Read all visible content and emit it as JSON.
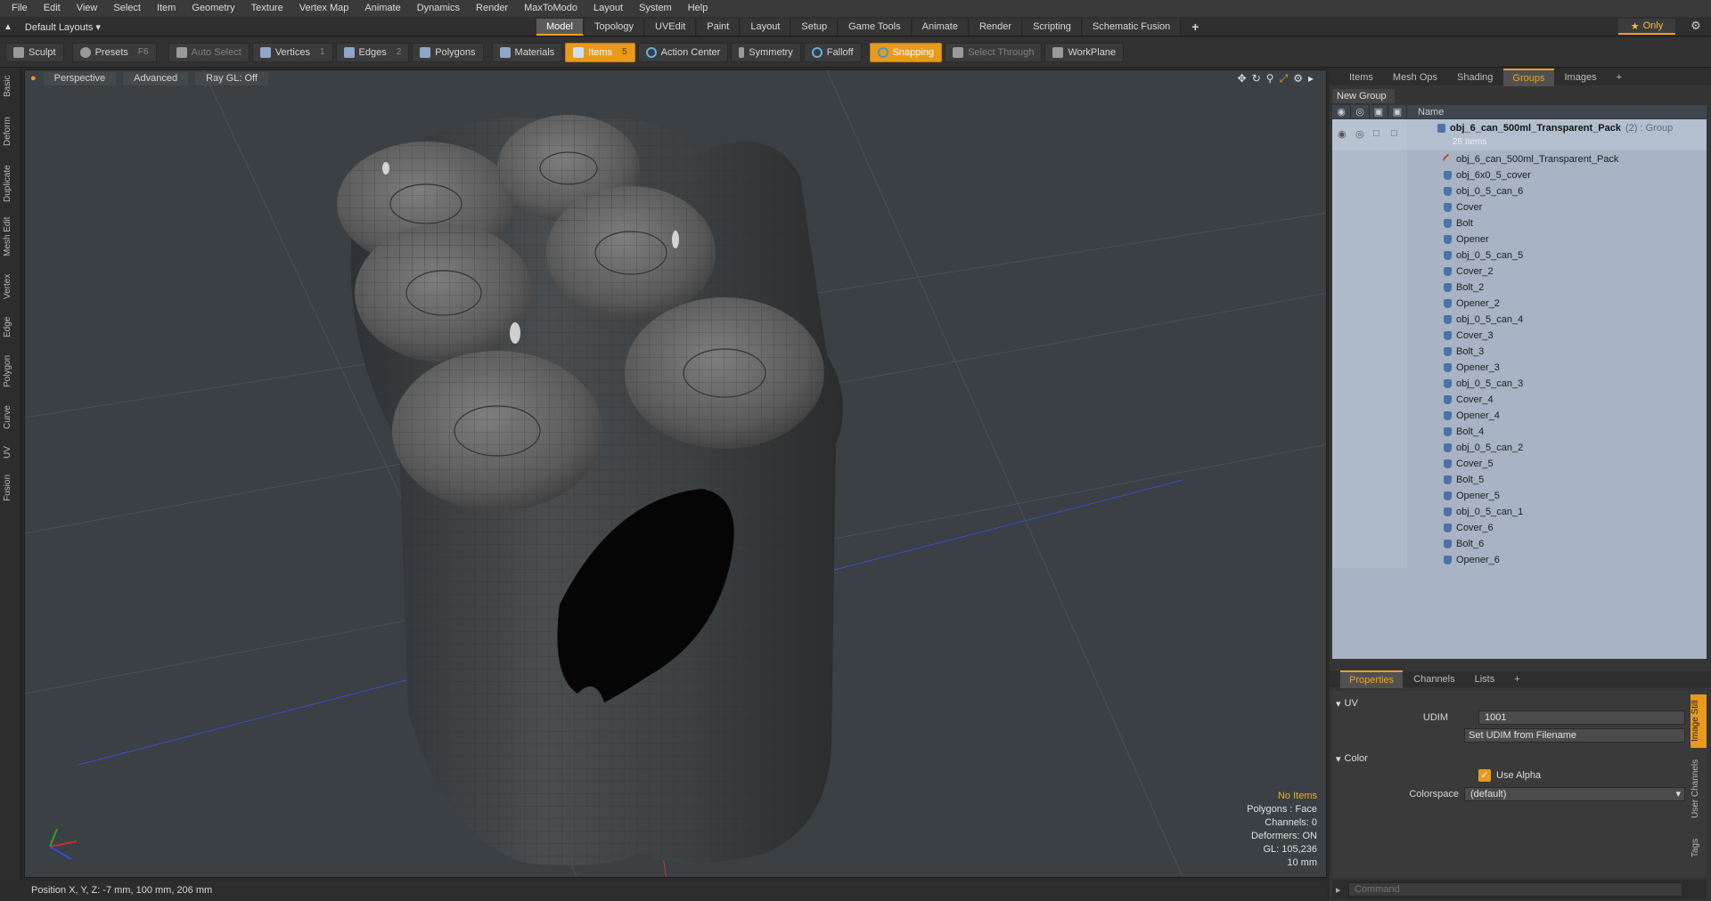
{
  "menu": [
    "File",
    "Edit",
    "View",
    "Select",
    "Item",
    "Geometry",
    "Texture",
    "Vertex Map",
    "Animate",
    "Dynamics",
    "Render",
    "MaxToModo",
    "Layout",
    "System",
    "Help"
  ],
  "layouts_label": "Default Layouts ▾",
  "tabs": [
    {
      "label": "Model",
      "active": true
    },
    {
      "label": "Topology",
      "active": false
    },
    {
      "label": "UVEdit",
      "active": false
    },
    {
      "label": "Paint",
      "active": false
    },
    {
      "label": "Layout",
      "active": false
    },
    {
      "label": "Setup",
      "active": false
    },
    {
      "label": "Game Tools",
      "active": false
    },
    {
      "label": "Animate",
      "active": false
    },
    {
      "label": "Render",
      "active": false
    },
    {
      "label": "Scripting",
      "active": false
    },
    {
      "label": "Schematic Fusion",
      "active": false
    }
  ],
  "only_label": "Only",
  "toolbar": {
    "sculpt": "Sculpt",
    "presets": "Presets",
    "presets_key": "F6",
    "auto_select": "Auto Select",
    "vertices": "Vertices",
    "vertices_key": "1",
    "edges": "Edges",
    "edges_key": "2",
    "polygons": "Polygons",
    "materials": "Materials",
    "items": "Items",
    "items_key": "5",
    "action_center": "Action Center",
    "symmetry": "Symmetry",
    "falloff": "Falloff",
    "snapping": "Snapping",
    "select_through": "Select Through",
    "workplane": "WorkPlane"
  },
  "side_tabs": [
    "Basic",
    "Deform",
    "Duplicate",
    "Mesh Edit",
    "Vertex",
    "Edge",
    "Polygon",
    "Curve",
    "UV",
    "Fusion"
  ],
  "viewport": {
    "view": "Perspective",
    "shading": "Advanced",
    "raygl": "Ray GL: Off",
    "info": {
      "no_items": "No Items",
      "polygons": "Polygons : Face",
      "channels": "Channels: 0",
      "deformers": "Deformers: ON",
      "gl": "GL: 105,236",
      "scale": "10 mm"
    }
  },
  "status_bar": "Position X, Y, Z:  -7 mm, 100 mm, 206 mm",
  "panel_tabs": [
    {
      "label": "Items",
      "active": false
    },
    {
      "label": "Mesh Ops",
      "active": false
    },
    {
      "label": "Shading",
      "active": false
    },
    {
      "label": "Groups",
      "active": true
    },
    {
      "label": "Images",
      "active": false
    }
  ],
  "new_group": "New Group",
  "tree_header_name": "Name",
  "group": {
    "name": "obj_6_can_500ml_Transparent_Pack",
    "suffix": "(2) : Group",
    "count": "26 Items"
  },
  "tree_items": [
    "obj_6_can_500ml_Transparent_Pack",
    "obj_6x0_5_cover",
    "obj_0_5_can_6",
    "Cover",
    "Bolt",
    "Opener",
    "obj_0_5_can_5",
    "Cover_2",
    "Bolt_2",
    "Opener_2",
    "obj_0_5_can_4",
    "Cover_3",
    "Bolt_3",
    "Opener_3",
    "obj_0_5_can_3",
    "Cover_4",
    "Opener_4",
    "Bolt_4",
    "obj_0_5_can_2",
    "Cover_5",
    "Bolt_5",
    "Opener_5",
    "obj_0_5_can_1",
    "Cover_6",
    "Bolt_6",
    "Opener_6"
  ],
  "props_tabs": [
    {
      "label": "Properties",
      "active": true
    },
    {
      "label": "Channels",
      "active": false
    },
    {
      "label": "Lists",
      "active": false
    }
  ],
  "props": {
    "uv_section": "UV",
    "udim_label": "UDIM",
    "udim_value": "1001",
    "set_udim": "Set UDIM from Filename",
    "color_section": "Color",
    "use_alpha": "Use Alpha",
    "colorspace_label": "Colorspace",
    "colorspace_value": "(default)"
  },
  "right_vtabs": [
    "Image Still",
    "User Channels",
    "Tags"
  ],
  "command_placeholder": "Command"
}
